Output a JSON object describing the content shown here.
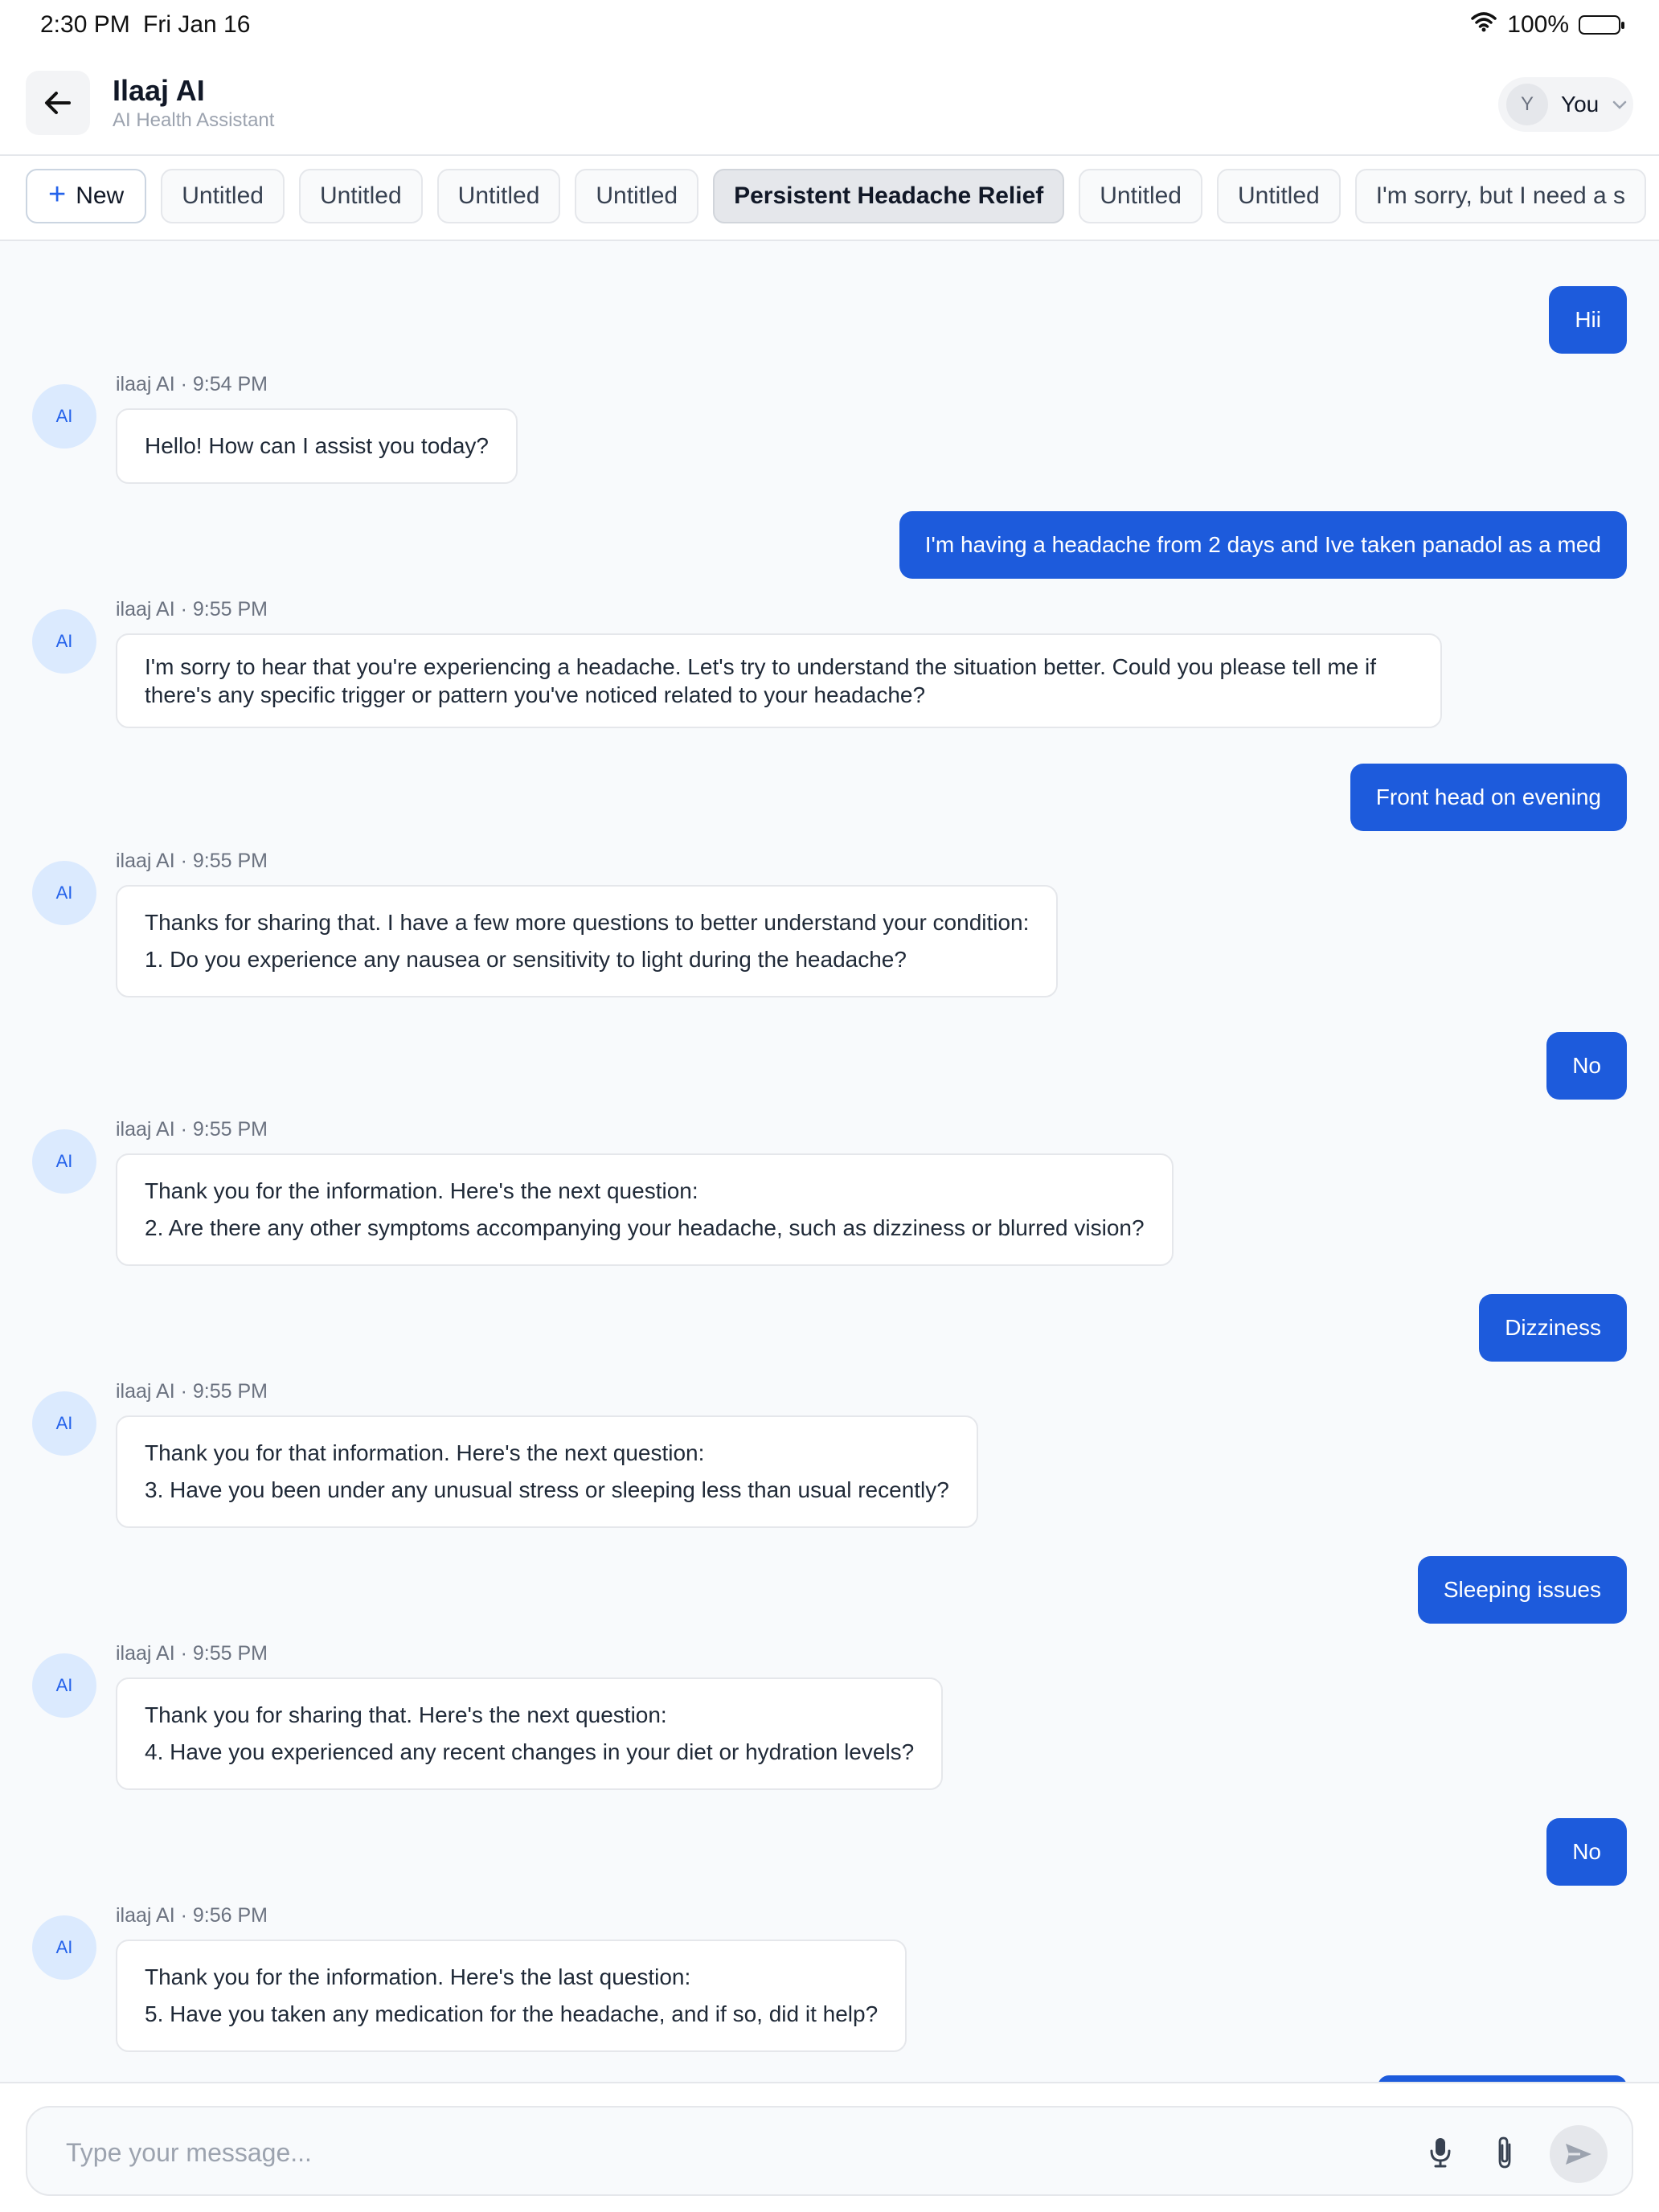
{
  "status_bar": {
    "time": "2:30 PM",
    "date": "Fri Jan 16",
    "battery": "100%"
  },
  "header": {
    "title": "Ilaaj AI",
    "subtitle": "AI Health Assistant",
    "user_initial": "Y",
    "user_label": "You"
  },
  "tabs": {
    "new_label": "New",
    "items": [
      {
        "label": "Untitled",
        "active": false
      },
      {
        "label": "Untitled",
        "active": false
      },
      {
        "label": "Untitled",
        "active": false
      },
      {
        "label": "Untitled",
        "active": false
      },
      {
        "label": "Persistent Headache Relief",
        "active": true
      },
      {
        "label": "Untitled",
        "active": false
      },
      {
        "label": "Untitled",
        "active": false
      },
      {
        "label": "I'm sorry, but I need a s",
        "active": false
      }
    ]
  },
  "chat": {
    "ai_avatar_label": "AI",
    "messages": [
      {
        "role": "user",
        "text": "Hii"
      },
      {
        "role": "ai",
        "meta": "ilaaj AI · 9:54 PM",
        "lines": [
          "Hello! How can I assist you today?"
        ]
      },
      {
        "role": "user",
        "text": "I'm having a headache from 2 days and Ive taken panadol as a med"
      },
      {
        "role": "ai",
        "meta": "ilaaj AI · 9:55 PM",
        "lines": [
          "I'm sorry to hear that you're experiencing a headache. Let's try to understand the situation better. Could you please tell me if there's any specific trigger or pattern you've noticed related to your headache?"
        ]
      },
      {
        "role": "user",
        "text": "Front head on evening"
      },
      {
        "role": "ai",
        "meta": "ilaaj AI · 9:55 PM",
        "lines": [
          "Thanks for sharing that. I have a few more questions to better understand your condition:",
          "1. Do you experience any nausea or sensitivity to light during the headache?"
        ]
      },
      {
        "role": "user",
        "text": "No"
      },
      {
        "role": "ai",
        "meta": "ilaaj AI · 9:55 PM",
        "lines": [
          "Thank you for the information. Here's the next question:",
          "2. Are there any other symptoms accompanying your headache, such as dizziness or blurred vision?"
        ]
      },
      {
        "role": "user",
        "text": "Dizziness"
      },
      {
        "role": "ai",
        "meta": "ilaaj AI · 9:55 PM",
        "lines": [
          "Thank you for that information. Here's the next question:",
          "3. Have you been under any unusual stress or sleeping less than usual recently?"
        ]
      },
      {
        "role": "user",
        "text": "Sleeping issues"
      },
      {
        "role": "ai",
        "meta": "ilaaj AI · 9:55 PM",
        "lines": [
          "Thank you for sharing that. Here's the next question:",
          "4. Have you experienced any recent changes in your diet or hydration levels?"
        ]
      },
      {
        "role": "user",
        "text": "No"
      },
      {
        "role": "ai",
        "meta": "ilaaj AI · 9:56 PM",
        "lines": [
          "Thank you for the information. Here's the last question:",
          "5. Have you taken any medication for the headache, and if so, did it help?"
        ]
      }
    ]
  },
  "composer": {
    "placeholder": "Type your message..."
  },
  "colors": {
    "accent": "#1d5bdc",
    "ai_avatar_bg": "#dbeafe",
    "background": "#f8fafc"
  },
  "icons": [
    "wifi-icon",
    "battery-icon",
    "back-arrow-icon",
    "chevron-down-icon",
    "plus-icon",
    "microphone-icon",
    "paperclip-icon",
    "send-icon"
  ]
}
